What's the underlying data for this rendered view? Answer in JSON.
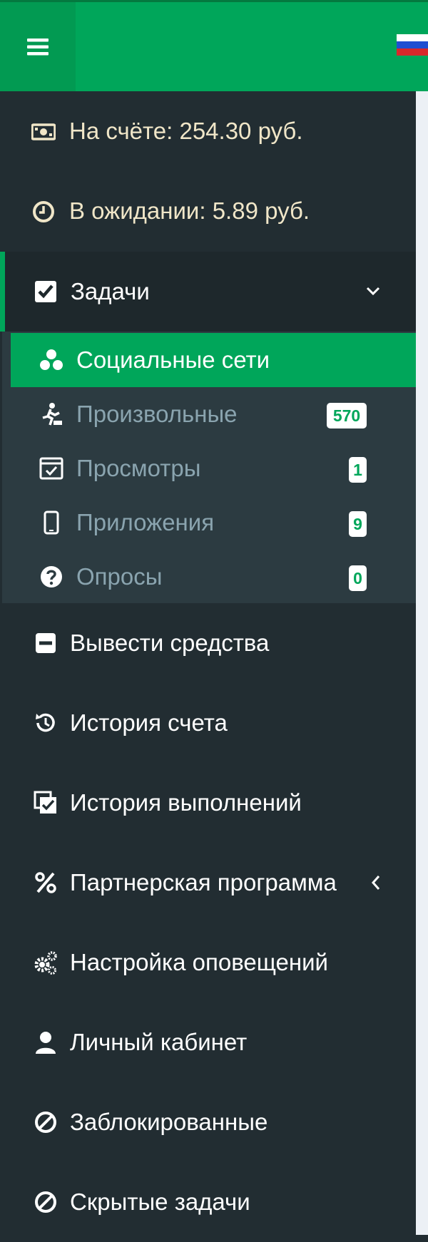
{
  "header": {
    "menu_icon": "hamburger-icon",
    "flag_icon": "russia-flag-icon",
    "colors": {
      "bar": "#00a65a",
      "toggle": "#029a52"
    }
  },
  "sidebar": {
    "balance": {
      "label": "На счёте: 254.30 руб.",
      "icon": "money-icon"
    },
    "pending": {
      "label": "В ожидании: 5.89 руб.",
      "icon": "clock-icon"
    },
    "tasks": {
      "label": "Задачи",
      "icon": "checkbox-icon",
      "expand_icon": "chevron-down-icon",
      "items": [
        {
          "label": "Социальные сети",
          "icon": "social-icon",
          "active": true
        },
        {
          "label": "Произвольные",
          "icon": "runner-icon",
          "badge": "570"
        },
        {
          "label": "Просмотры",
          "icon": "browser-check-icon",
          "badge": "1"
        },
        {
          "label": "Приложения",
          "icon": "mobile-icon",
          "badge": "9"
        },
        {
          "label": "Опросы",
          "icon": "question-icon",
          "badge": "0"
        }
      ]
    },
    "menu": [
      {
        "label": "Вывести средства",
        "icon": "minus-square-icon"
      },
      {
        "label": "История счета",
        "icon": "history-icon"
      },
      {
        "label": "История выполнений",
        "icon": "done-history-icon"
      },
      {
        "label": "Партнерская программа",
        "icon": "percent-icon",
        "expand_icon": "chevron-left-icon"
      },
      {
        "label": "Настройка оповещений",
        "icon": "cogs-icon"
      },
      {
        "label": "Личный кабинет",
        "icon": "user-icon"
      },
      {
        "label": "Заблокированные",
        "icon": "ban-icon"
      },
      {
        "label": "Скрытые задачи",
        "icon": "ban-icon"
      }
    ],
    "colors": {
      "background": "#222d32",
      "submenu": "#2c3b41",
      "accent": "#00a65a",
      "balance_text": "#f0e6c8",
      "submenu_text": "#8aa4af"
    }
  }
}
